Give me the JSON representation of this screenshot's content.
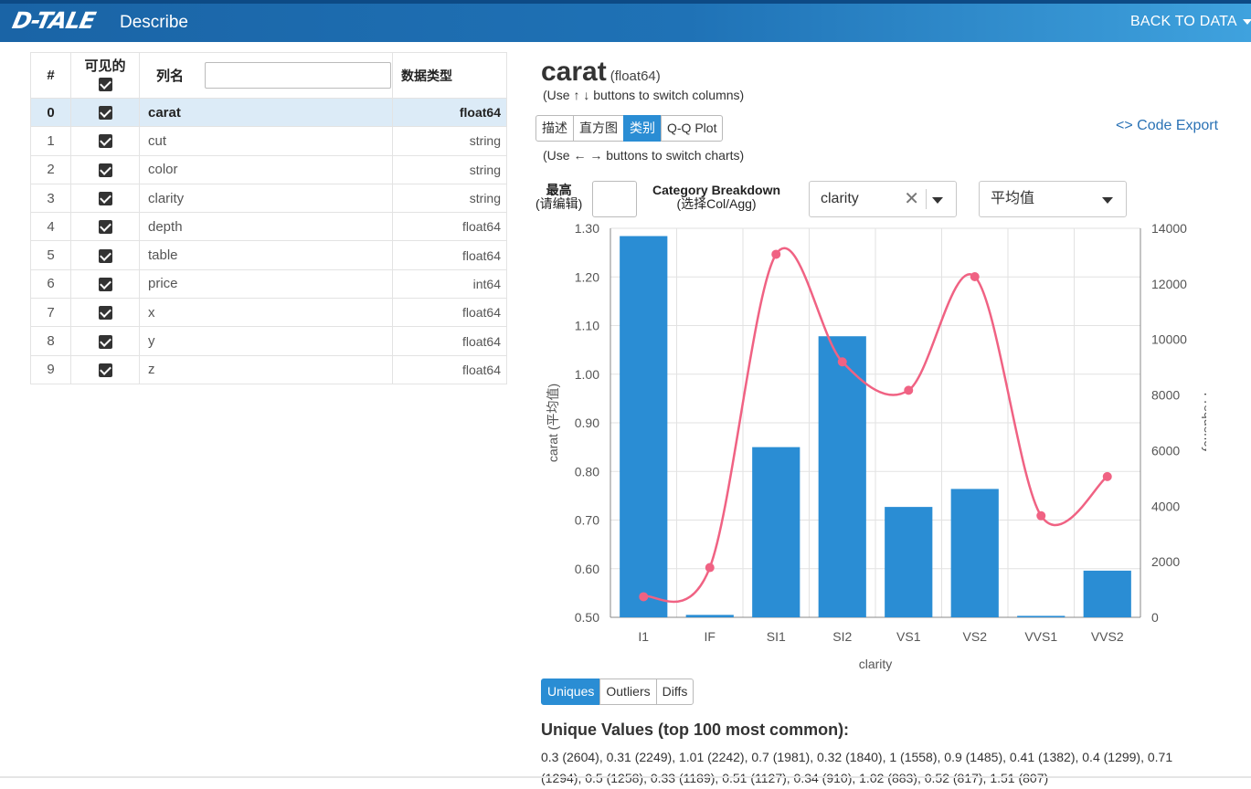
{
  "header": {
    "logo": "D-TALE",
    "title": "Describe",
    "back_label": "BACK TO DATA"
  },
  "columns_table": {
    "headers": {
      "index": "#",
      "visible": "可见的",
      "name": "列名",
      "dtype": "数据类型"
    },
    "name_filter_value": "",
    "rows": [
      {
        "index": "0",
        "name": "carat",
        "dtype": "float64",
        "visible": true,
        "selected": true
      },
      {
        "index": "1",
        "name": "cut",
        "dtype": "string",
        "visible": true
      },
      {
        "index": "2",
        "name": "color",
        "dtype": "string",
        "visible": true
      },
      {
        "index": "3",
        "name": "clarity",
        "dtype": "string",
        "visible": true
      },
      {
        "index": "4",
        "name": "depth",
        "dtype": "float64",
        "visible": true
      },
      {
        "index": "5",
        "name": "table",
        "dtype": "float64",
        "visible": true
      },
      {
        "index": "6",
        "name": "price",
        "dtype": "int64",
        "visible": true
      },
      {
        "index": "7",
        "name": "x",
        "dtype": "float64",
        "visible": true
      },
      {
        "index": "8",
        "name": "y",
        "dtype": "float64",
        "visible": true
      },
      {
        "index": "9",
        "name": "z",
        "dtype": "float64",
        "visible": true
      }
    ]
  },
  "detail": {
    "column_name": "carat",
    "column_dtype": "(float64)",
    "hint_columns": "(Use ↑ ↓ buttons to switch columns)",
    "hint_charts": "(Use ← → buttons to switch charts)",
    "chart_tabs": [
      "描述",
      "直方图",
      "类别",
      "Q-Q Plot"
    ],
    "active_chart_tab": "类别",
    "code_export": "<> Code Export",
    "top_label_line1": "最高",
    "top_label_line2": "(请编辑)",
    "top_value": "",
    "category_label_line1": "Category Breakdown",
    "category_label_line2": "(选择Col/Agg)",
    "category_col": "clarity",
    "aggregation": "平均值",
    "value_tabs": [
      "Uniques",
      "Outliers",
      "Diffs"
    ],
    "active_value_tab": "Uniques",
    "uniques_title": "Unique Values (top 100 most common):",
    "uniques_text": "0.3 (2604), 0.31 (2249), 1.01 (2242), 0.7 (1981), 0.32 (1840), 1 (1558), 0.9 (1485), 0.41 (1382), 0.4 (1299), 0.71 (1294), 0.5 (1258), 0.33 (1189), 0.51 (1127), 0.34 (910), 1.02 (883), 0.52 (817), 1.51 (807)"
  },
  "colors": {
    "accent": "#2a8dd4",
    "bar": "#2a8dd4",
    "line": "#f06283",
    "header_start": "#1a64a6",
    "header_end": "#3fa2de",
    "selected_row": "#dcebf7"
  },
  "chart_data": {
    "type": "bar",
    "categories": [
      "I1",
      "IF",
      "SI1",
      "SI2",
      "VS1",
      "VS2",
      "VVS1",
      "VVS2"
    ],
    "xlabel": "clarity",
    "ylabel": "carat (平均值)",
    "y2label": "Frequency",
    "ylim": [
      0.5,
      1.3
    ],
    "y2lim": [
      0,
      14000
    ],
    "yticks": [
      "0.50",
      "0.60",
      "0.70",
      "0.80",
      "0.90",
      "1.00",
      "1.10",
      "1.20",
      "1.30"
    ],
    "y2ticks": [
      "0",
      "2000",
      "4000",
      "6000",
      "8000",
      "10000",
      "12000",
      "14000"
    ],
    "grid": true,
    "series": [
      {
        "type": "bar",
        "axis": "left",
        "values": [
          1.284,
          0.505,
          0.85,
          1.078,
          0.727,
          0.764,
          0.503,
          0.596
        ]
      },
      {
        "type": "line",
        "axis": "right",
        "values": [
          741,
          1790,
          13065,
          9194,
          8171,
          12258,
          3655,
          5066
        ]
      }
    ]
  }
}
